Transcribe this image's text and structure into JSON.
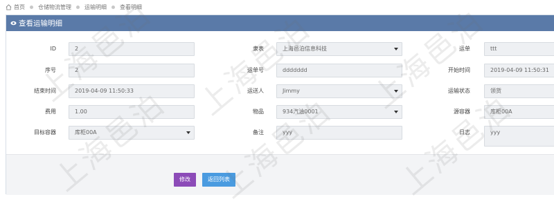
{
  "breadcrumb": {
    "items": [
      "首页",
      "仓储物流管理",
      "运输明细",
      "查看明细"
    ]
  },
  "panel": {
    "title": "查看运输明细",
    "icon": "eye-icon"
  },
  "form": {
    "id": {
      "label": "ID",
      "value": "2"
    },
    "table": {
      "label": "隶表",
      "value": "上海邑泊信息科技"
    },
    "waybill": {
      "label": "运单",
      "value": "ttt"
    },
    "seq": {
      "label": "序号",
      "value": "2"
    },
    "waybill_no": {
      "label": "运单号",
      "value": "ddddddd"
    },
    "start_time": {
      "label": "开始时间",
      "value": "2019-04-09 11:50:31"
    },
    "end_time": {
      "label": "结束时间",
      "value": "2019-04-09 11:50:33"
    },
    "shipper": {
      "label": "运送人",
      "value": "Jimmy"
    },
    "status": {
      "label": "运输状态",
      "value": "领货"
    },
    "cost": {
      "label": "费用",
      "value": "1.00"
    },
    "goods": {
      "label": "物品",
      "value": "934汽油0001"
    },
    "source_container": {
      "label": "源容器",
      "value": "库柜00A"
    },
    "target_container": {
      "label": "目标容器",
      "value": "库柜00A"
    },
    "remark": {
      "label": "备注",
      "value": "yyy"
    },
    "log": {
      "label": "日志",
      "value": "yyy"
    }
  },
  "buttons": {
    "edit": "修改",
    "back": "返回列表"
  },
  "watermark": "上海邑泊",
  "colors": {
    "header": "#5a7aa8",
    "edit_button": "#8c4bb8",
    "back_button": "#4a9be0"
  }
}
